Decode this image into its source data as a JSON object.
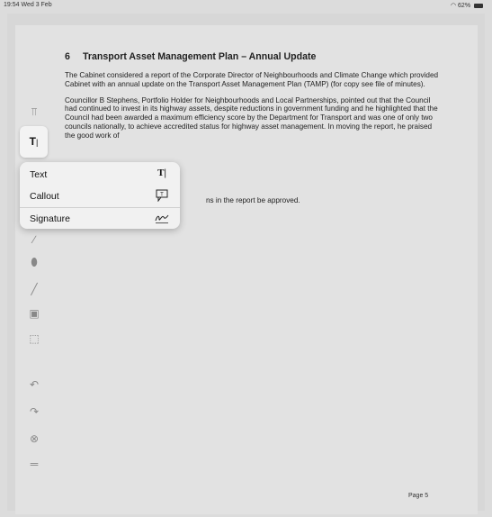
{
  "status_bar": {
    "time": "19:54",
    "date": "Wed 3 Feb",
    "battery": "62%"
  },
  "document": {
    "section_number": "6",
    "heading": "Transport Asset Management Plan – Annual Update",
    "paragraph1": "The Cabinet considered a report of the Corporate Director of Neighbourhoods and Climate Change which provided Cabinet with an annual update on the Transport Asset Management Plan (TAMP) (for copy see file of minutes).",
    "paragraph2": "Councillor B Stephens, Portfolio Holder for Neighbourhoods and Local Partnerships, pointed out that the Council had continued to invest in its highway assets, despite reductions in government funding and he highlighted that the Council had been awarded a maximum efficiency score by the Department for Transport and was one of only two councils nationally, to achieve accredited status for highway asset management.  In moving the report, he praised the good work of",
    "partial_line": "ns in the report be approved.",
    "page_label": "Page 5"
  },
  "menu": {
    "items": [
      {
        "label": "Text",
        "icon": "text-tool-icon"
      },
      {
        "label": "Callout",
        "icon": "callout-icon"
      },
      {
        "label": "Signature",
        "icon": "signature-icon"
      }
    ]
  },
  "toolbar": {
    "active_tool": "text",
    "tools": [
      "highlight",
      "text",
      "ruler",
      "brush",
      "eraser",
      "line",
      "image",
      "selection",
      "undo",
      "redo",
      "close",
      "menu"
    ]
  }
}
